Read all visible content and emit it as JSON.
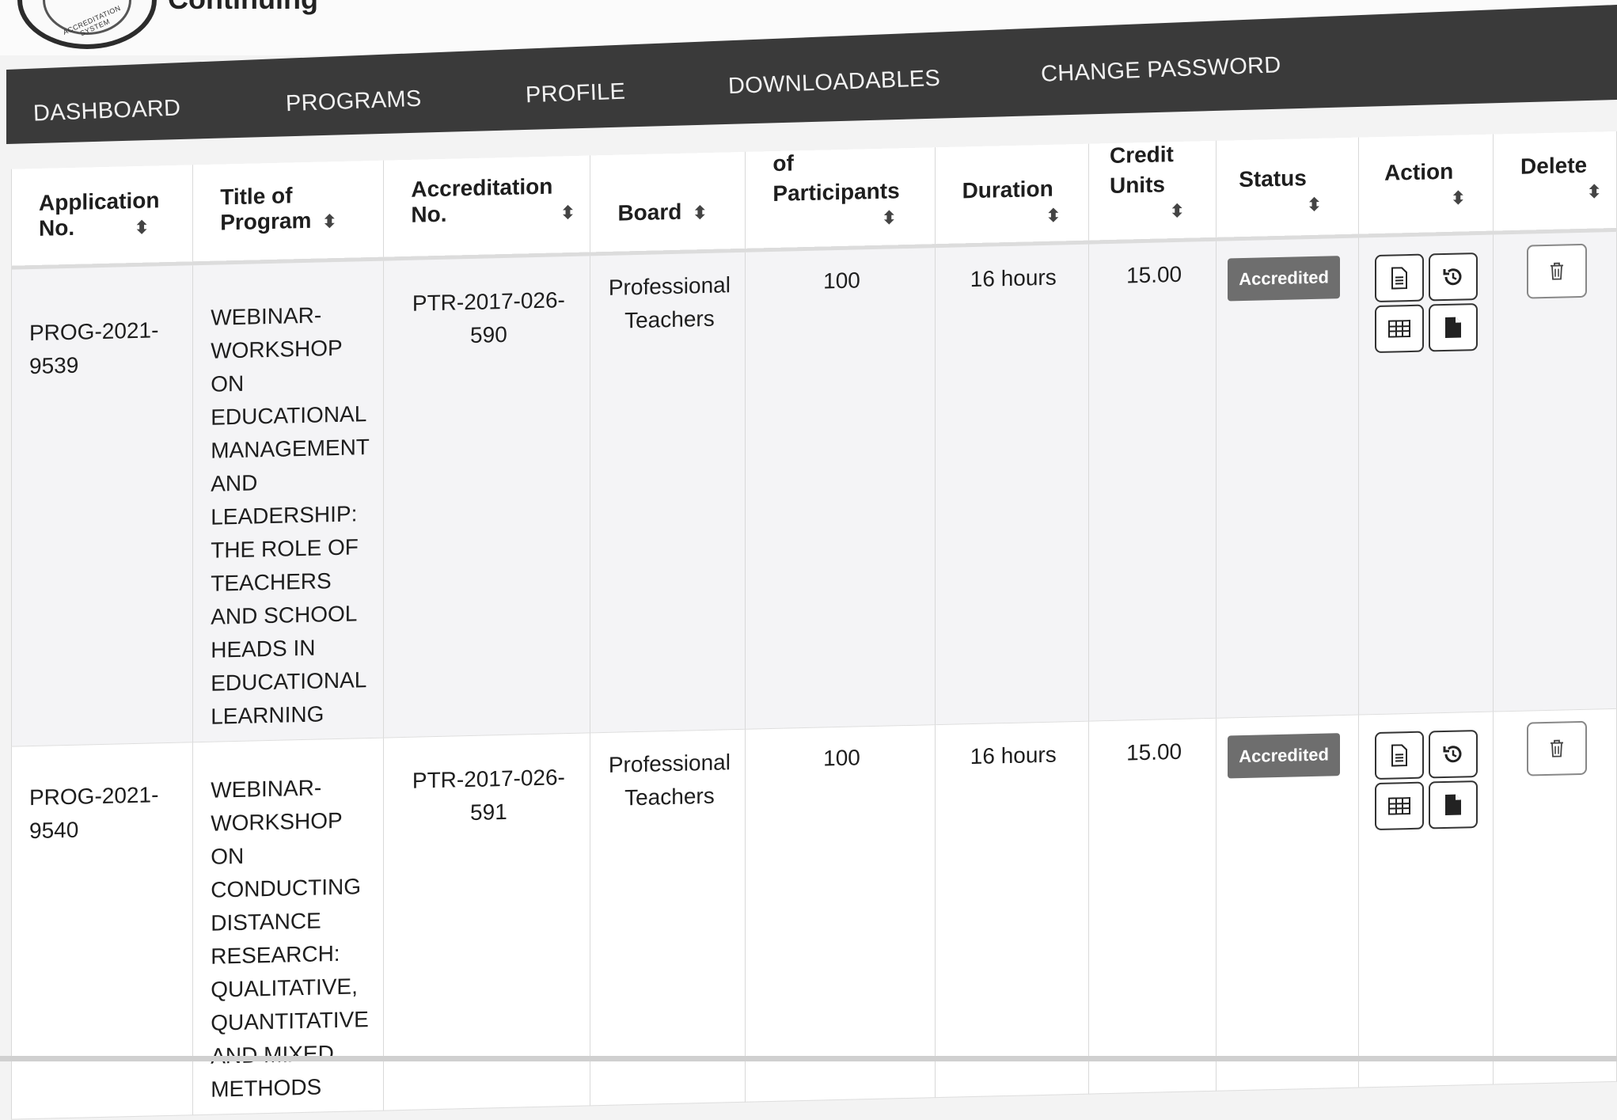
{
  "brand": {
    "title": "Continuing",
    "logo_text": "ACCREDITATION SYSTEM"
  },
  "nav": {
    "items": [
      "DASHBOARD",
      "PROGRAMS",
      "PROFILE",
      "DOWNLOADABLES",
      "CHANGE PASSWORD"
    ]
  },
  "table": {
    "headers": {
      "application_no": [
        "Application",
        "No."
      ],
      "title": [
        "Title of",
        "Program"
      ],
      "accreditation_no": [
        "Accreditation",
        "No."
      ],
      "board": "Board",
      "participants": [
        "of",
        "Participants"
      ],
      "duration": "Duration",
      "credit_units": [
        "Credit",
        "Units"
      ],
      "status": "Status",
      "action": "Action",
      "delete": "Delete"
    },
    "sort_glyph": "⬍",
    "rows": [
      {
        "application_no": "PROG-2021-9539",
        "title": "WEBINAR-WORKSHOP ON EDUCATIONAL MANAGEMENT AND LEADERSHIP: THE ROLE OF TEACHERS AND SCHOOL HEADS IN EDUCATIONAL LEARNING",
        "accreditation_no": "PTR-2017-026-590",
        "board": "Professional Teachers",
        "participants": "100",
        "duration": "16 hours",
        "credit_units": "15.00",
        "status": "Accredited"
      },
      {
        "application_no": "PROG-2021-9540",
        "title": "WEBINAR-WORKSHOP ON CONDUCTING DISTANCE RESEARCH: QUALITATIVE, QUANTITATIVE AND MIXED METHODS",
        "accreditation_no": "PTR-2017-026-591",
        "board": "Professional Teachers",
        "participants": "100",
        "duration": "16 hours",
        "credit_units": "15.00",
        "status": "Accredited"
      }
    ],
    "action_icons": [
      "document-icon",
      "history-icon",
      "table-icon",
      "file-icon"
    ],
    "delete_icon": "trash-icon"
  },
  "colors": {
    "navbar": "#3a3a3a",
    "badge": "#6e6e6e",
    "row_alt": "#f4f4f6"
  }
}
